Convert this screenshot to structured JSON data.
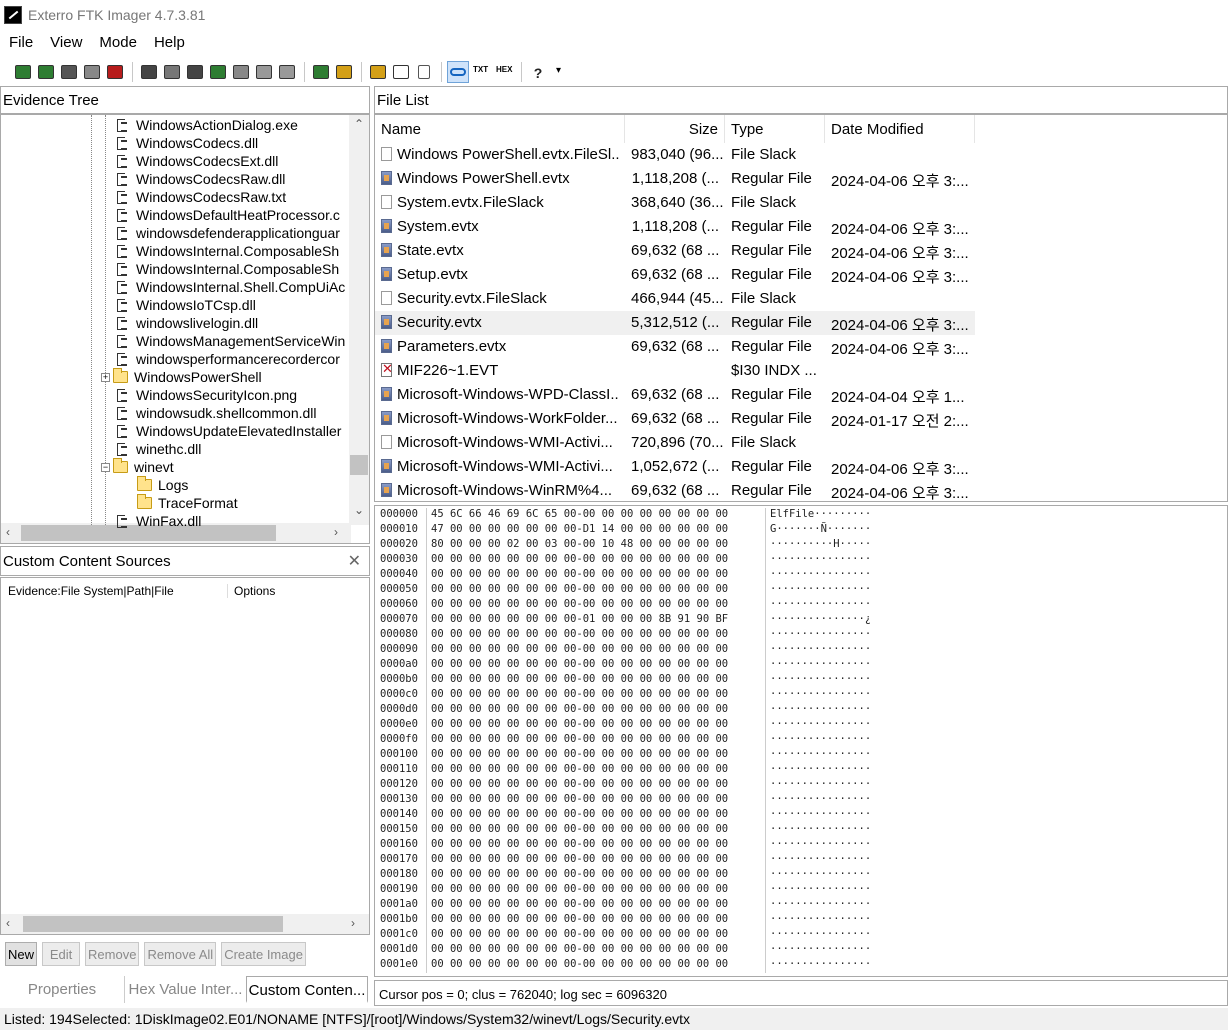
{
  "window": {
    "title": "Exterro FTK Imager 4.7.3.81"
  },
  "menu": [
    "File",
    "View",
    "Mode",
    "Help"
  ],
  "toolbar": {
    "icons": [
      "add-evidence-icon",
      "add-all-evidence-icon",
      "image-mounting-icon",
      "remove-evidence-icon",
      "remove-all-icon",
      "create-disk-image-icon",
      "export-disk-image-icon",
      "export-logical-image-icon",
      "add-to-custom-content-icon",
      "create-custom-content-image-icon",
      "decrypt-icon",
      "detect-encryption-icon",
      "export-files-icon",
      "export-hash-list-icon",
      "verify-drive-icon",
      "capture-memory-icon",
      "obtain-protected-files-icon",
      "view-files-icon",
      "view-text-icon",
      "view-hex-icon",
      "help-icon",
      "dropdown-icon"
    ]
  },
  "evidence_tree": {
    "header": "Evidence Tree",
    "items": [
      {
        "label": "WindowsActionDialog.exe",
        "type": "file"
      },
      {
        "label": "WindowsCodecs.dll",
        "type": "file"
      },
      {
        "label": "WindowsCodecsExt.dll",
        "type": "file"
      },
      {
        "label": "WindowsCodecsRaw.dll",
        "type": "file"
      },
      {
        "label": "WindowsCodecsRaw.txt",
        "type": "file"
      },
      {
        "label": "WindowsDefaultHeatProcessor.c",
        "type": "file"
      },
      {
        "label": "windowsdefenderapplicationguar",
        "type": "file"
      },
      {
        "label": "WindowsInternal.ComposableSh",
        "type": "file"
      },
      {
        "label": "WindowsInternal.ComposableSh",
        "type": "file"
      },
      {
        "label": "WindowsInternal.Shell.CompUiAc",
        "type": "file"
      },
      {
        "label": "WindowsIoTCsp.dll",
        "type": "file"
      },
      {
        "label": "windowslivelogin.dll",
        "type": "file"
      },
      {
        "label": "WindowsManagementServiceWin",
        "type": "file"
      },
      {
        "label": "windowsperformancerecordercor",
        "type": "file"
      },
      {
        "label": "WindowsPowerShell",
        "type": "folder-collapsed"
      },
      {
        "label": "WindowsSecurityIcon.png",
        "type": "file"
      },
      {
        "label": "windowsudk.shellcommon.dll",
        "type": "file"
      },
      {
        "label": "WindowsUpdateElevatedInstaller",
        "type": "file"
      },
      {
        "label": "winethc.dll",
        "type": "file"
      },
      {
        "label": "winevt",
        "type": "folder-expanded"
      },
      {
        "label": "Logs",
        "type": "subfolder"
      },
      {
        "label": "TraceFormat",
        "type": "subfolder"
      },
      {
        "label": "WinFax.dll",
        "type": "file"
      }
    ]
  },
  "custom_content": {
    "header": "Custom Content Sources",
    "col_evidence": "Evidence:File System|Path|File",
    "col_options": "Options",
    "buttons": [
      "New",
      "Edit",
      "Remove",
      "Remove All",
      "Create Image"
    ]
  },
  "bottom_tabs": [
    "Properties",
    "Hex Value Inter...",
    "Custom Conten..."
  ],
  "file_list": {
    "header": "File List",
    "columns": [
      "Name",
      "Size",
      "Type",
      "Date Modified"
    ],
    "rows": [
      {
        "name": "Windows PowerShell.evtx.FileSl...",
        "size": "983,040 (96...",
        "type": "File Slack",
        "date": "",
        "icon": "slack"
      },
      {
        "name": "Windows PowerShell.evtx",
        "size": "1,118,208 (...",
        "type": "Regular File",
        "date": "2024-04-06 오후 3:...",
        "icon": "regular"
      },
      {
        "name": "System.evtx.FileSlack",
        "size": "368,640 (36...",
        "type": "File Slack",
        "date": "",
        "icon": "slack"
      },
      {
        "name": "System.evtx",
        "size": "1,118,208 (...",
        "type": "Regular File",
        "date": "2024-04-06 오후 3:...",
        "icon": "regular"
      },
      {
        "name": "State.evtx",
        "size": "69,632 (68 ...",
        "type": "Regular File",
        "date": "2024-04-06 오후 3:...",
        "icon": "regular"
      },
      {
        "name": "Setup.evtx",
        "size": "69,632 (68 ...",
        "type": "Regular File",
        "date": "2024-04-06 오후 3:...",
        "icon": "regular"
      },
      {
        "name": "Security.evtx.FileSlack",
        "size": "466,944 (45...",
        "type": "File Slack",
        "date": "",
        "icon": "slack"
      },
      {
        "name": "Security.evtx",
        "size": "5,312,512 (...",
        "type": "Regular File",
        "date": "2024-04-06 오후 3:...",
        "icon": "regular",
        "selected": true
      },
      {
        "name": "Parameters.evtx",
        "size": "69,632 (68 ...",
        "type": "Regular File",
        "date": "2024-04-06 오후 3:...",
        "icon": "regular"
      },
      {
        "name": "MIF226~1.EVT",
        "size": "",
        "type": "$I30 INDX ...",
        "date": "",
        "icon": "deleted"
      },
      {
        "name": "Microsoft-Windows-WPD-ClassI...",
        "size": "69,632 (68 ...",
        "type": "Regular File",
        "date": "2024-04-04 오후 1...",
        "icon": "regular"
      },
      {
        "name": "Microsoft-Windows-WorkFolder...",
        "size": "69,632 (68 ...",
        "type": "Regular File",
        "date": "2024-01-17 오전 2:...",
        "icon": "regular"
      },
      {
        "name": "Microsoft-Windows-WMI-Activi...",
        "size": "720,896 (70...",
        "type": "File Slack",
        "date": "",
        "icon": "slack"
      },
      {
        "name": "Microsoft-Windows-WMI-Activi...",
        "size": "1,052,672 (...",
        "type": "Regular File",
        "date": "2024-04-06 오후 3:...",
        "icon": "regular"
      },
      {
        "name": "Microsoft-Windows-WinRM%4...",
        "size": "69,632 (68 ...",
        "type": "Regular File",
        "date": "2024-04-06 오후 3:...",
        "icon": "regular"
      }
    ]
  },
  "hex": {
    "rows": [
      {
        "off": "000000",
        "bytes": "45 6C 66 46 69 6C 65 00-00 00 00 00 00 00 00 00",
        "ascii": "ElfFile·········"
      },
      {
        "off": "000010",
        "bytes": "47 00 00 00 00 00 00 00-D1 14 00 00 00 00 00 00",
        "ascii": "G·······Ñ·······"
      },
      {
        "off": "000020",
        "bytes": "80 00 00 00 02 00 03 00-00 10 48 00 00 00 00 00",
        "ascii": "··········H·····"
      },
      {
        "off": "000030",
        "bytes": "00 00 00 00 00 00 00 00-00 00 00 00 00 00 00 00",
        "ascii": "················"
      },
      {
        "off": "000040",
        "bytes": "00 00 00 00 00 00 00 00-00 00 00 00 00 00 00 00",
        "ascii": "················"
      },
      {
        "off": "000050",
        "bytes": "00 00 00 00 00 00 00 00-00 00 00 00 00 00 00 00",
        "ascii": "················"
      },
      {
        "off": "000060",
        "bytes": "00 00 00 00 00 00 00 00-00 00 00 00 00 00 00 00",
        "ascii": "················"
      },
      {
        "off": "000070",
        "bytes": "00 00 00 00 00 00 00 00-01 00 00 00 8B 91 90 BF",
        "ascii": "···············¿"
      },
      {
        "off": "000080",
        "bytes": "00 00 00 00 00 00 00 00-00 00 00 00 00 00 00 00",
        "ascii": "················"
      },
      {
        "off": "000090",
        "bytes": "00 00 00 00 00 00 00 00-00 00 00 00 00 00 00 00",
        "ascii": "················"
      },
      {
        "off": "0000a0",
        "bytes": "00 00 00 00 00 00 00 00-00 00 00 00 00 00 00 00",
        "ascii": "················"
      },
      {
        "off": "0000b0",
        "bytes": "00 00 00 00 00 00 00 00-00 00 00 00 00 00 00 00",
        "ascii": "················"
      },
      {
        "off": "0000c0",
        "bytes": "00 00 00 00 00 00 00 00-00 00 00 00 00 00 00 00",
        "ascii": "················"
      },
      {
        "off": "0000d0",
        "bytes": "00 00 00 00 00 00 00 00-00 00 00 00 00 00 00 00",
        "ascii": "················"
      },
      {
        "off": "0000e0",
        "bytes": "00 00 00 00 00 00 00 00-00 00 00 00 00 00 00 00",
        "ascii": "················"
      },
      {
        "off": "0000f0",
        "bytes": "00 00 00 00 00 00 00 00-00 00 00 00 00 00 00 00",
        "ascii": "················"
      },
      {
        "off": "000100",
        "bytes": "00 00 00 00 00 00 00 00-00 00 00 00 00 00 00 00",
        "ascii": "················"
      },
      {
        "off": "000110",
        "bytes": "00 00 00 00 00 00 00 00-00 00 00 00 00 00 00 00",
        "ascii": "················"
      },
      {
        "off": "000120",
        "bytes": "00 00 00 00 00 00 00 00-00 00 00 00 00 00 00 00",
        "ascii": "················"
      },
      {
        "off": "000130",
        "bytes": "00 00 00 00 00 00 00 00-00 00 00 00 00 00 00 00",
        "ascii": "················"
      },
      {
        "off": "000140",
        "bytes": "00 00 00 00 00 00 00 00-00 00 00 00 00 00 00 00",
        "ascii": "················"
      },
      {
        "off": "000150",
        "bytes": "00 00 00 00 00 00 00 00-00 00 00 00 00 00 00 00",
        "ascii": "················"
      },
      {
        "off": "000160",
        "bytes": "00 00 00 00 00 00 00 00-00 00 00 00 00 00 00 00",
        "ascii": "················"
      },
      {
        "off": "000170",
        "bytes": "00 00 00 00 00 00 00 00-00 00 00 00 00 00 00 00",
        "ascii": "················"
      },
      {
        "off": "000180",
        "bytes": "00 00 00 00 00 00 00 00-00 00 00 00 00 00 00 00",
        "ascii": "················"
      },
      {
        "off": "000190",
        "bytes": "00 00 00 00 00 00 00 00-00 00 00 00 00 00 00 00",
        "ascii": "················"
      },
      {
        "off": "0001a0",
        "bytes": "00 00 00 00 00 00 00 00-00 00 00 00 00 00 00 00",
        "ascii": "················"
      },
      {
        "off": "0001b0",
        "bytes": "00 00 00 00 00 00 00 00-00 00 00 00 00 00 00 00",
        "ascii": "················"
      },
      {
        "off": "0001c0",
        "bytes": "00 00 00 00 00 00 00 00-00 00 00 00 00 00 00 00",
        "ascii": "················"
      },
      {
        "off": "0001d0",
        "bytes": "00 00 00 00 00 00 00 00-00 00 00 00 00 00 00 00",
        "ascii": "················"
      },
      {
        "off": "0001e0",
        "bytes": "00 00 00 00 00 00 00 00-00 00 00 00 00 00 00 00",
        "ascii": "················"
      }
    ]
  },
  "hex_status": "Cursor pos = 0; clus = 762040; log sec = 6096320",
  "status_bar": "Listed: 194Selected: 1DiskImage02.E01/NONAME [NTFS]/[root]/Windows/System32/winevt/Logs/Security.evtx"
}
